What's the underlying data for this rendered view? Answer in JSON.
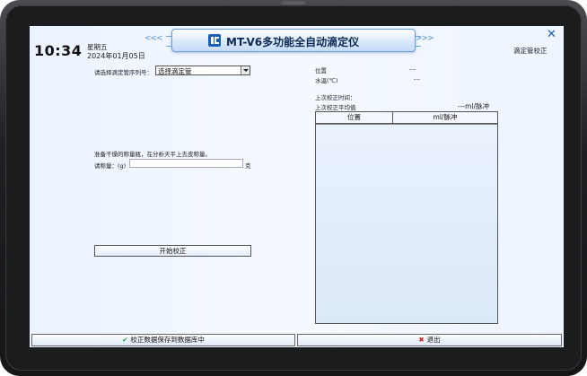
{
  "header": {
    "time": "10:34",
    "weekday": "星期五",
    "date": "2024年01月05日",
    "title": "MT-V6多功能全自动滴定仪",
    "chevrons_left": "<<<",
    "chevrons_right": ">>>",
    "close_glyph": "✕",
    "page_name": "滴定管校正"
  },
  "left": {
    "tube_label": "请选择滴定管序列号：",
    "tube_select_value": "选择滴定管",
    "weigh_instruction": "准备干燥的称量瓶，在分析天平上去皮称量。",
    "weight_label": "请称量：(g)",
    "weight_value": "",
    "weight_unit": "克",
    "start_button": "开始校正"
  },
  "right": {
    "position_label": "位置",
    "position_value": "---",
    "water_temp_label": "水温(℃)",
    "water_temp_value": "---",
    "last_calib_time_label": "上次校正时间：",
    "last_calib_avg_label": "上次校正平均值",
    "last_calib_avg_value": "---ml/脉冲",
    "table_headers": [
      "位置",
      "ml/脉冲"
    ]
  },
  "footer": {
    "save_label": "校正数据保存到数据库中",
    "exit_label": "退出"
  },
  "colors": {
    "accent": "#1a5fb4",
    "check": "#2e9c3a",
    "exit": "#cc1f1f"
  }
}
